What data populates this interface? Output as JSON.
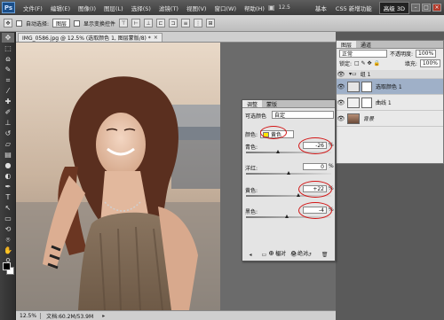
{
  "app": {
    "logo": "Ps"
  },
  "menubar": {
    "items": [
      "文件(F)",
      "编辑(E)",
      "图像(I)",
      "图层(L)",
      "选择(S)",
      "滤镜(T)",
      "视图(V)",
      "窗口(W)",
      "帮助(H)"
    ],
    "zoom": "12.5",
    "workspaces": {
      "basic": "基本",
      "new": "CS5 新增功能",
      "advanced": "高级 3D"
    },
    "window_controls": {
      "minimize": "–",
      "maximize": "□",
      "close": "×"
    }
  },
  "options": {
    "auto_select_label": "自动选择:",
    "auto_select_value": "图层",
    "show_transform_label": "显示变换控件"
  },
  "document": {
    "tab_label": "IMG_0586.jpg @ 12.5% (选取颜色 1, 图层蒙版/8) *",
    "close": "×",
    "status_zoom": "12.5%",
    "status_doc": "文档:60.2M/53.9M",
    "status_arrow": "▸"
  },
  "layers_panel": {
    "tabs": [
      "图层",
      "通道"
    ],
    "blend_mode": "正常",
    "opacity_label": "不透明度:",
    "opacity": "100%",
    "lock_label": "锁定:",
    "fill_label": "填充:",
    "fill": "100%",
    "layers": [
      {
        "name": "组 1"
      },
      {
        "name": "选取颜色 1"
      },
      {
        "name": "曲线 1"
      },
      {
        "name": "背景"
      }
    ]
  },
  "adjustments": {
    "tabs": [
      "调整",
      "蒙版"
    ],
    "title": "可选颜色",
    "preset": "自定",
    "colors_label": "颜色:",
    "color_value": "黄色",
    "color_swatch": "#ffe600",
    "rows": [
      {
        "label": "青色:",
        "value": "-26",
        "thumb": 0.37
      },
      {
        "label": "洋红:",
        "value": "0",
        "thumb": 0.5
      },
      {
        "label": "黄色:",
        "value": "+22",
        "thumb": 0.61
      },
      {
        "label": "黑色:",
        "value": "-4",
        "thumb": 0.48
      }
    ],
    "percent": "%",
    "method_relative": "相对",
    "method_absolute": "绝对"
  },
  "colors": {
    "highlight": "#d31616",
    "fg": "#000000",
    "bg": "#ffffff"
  }
}
